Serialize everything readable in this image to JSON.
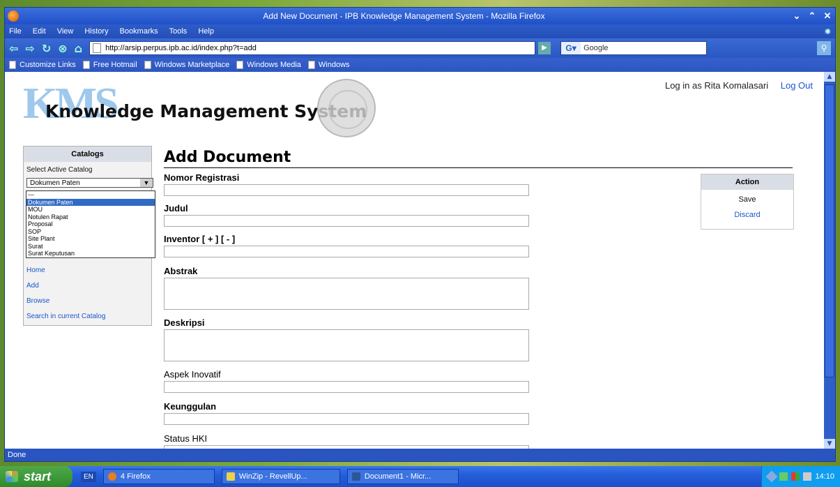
{
  "window": {
    "title": "Add New Document - IPB Knowledge Management System - Mozilla Firefox",
    "controls": [
      "⌄",
      "⌃",
      "✕"
    ]
  },
  "menu": [
    "File",
    "Edit",
    "View",
    "History",
    "Bookmarks",
    "Tools",
    "Help"
  ],
  "nav": {
    "url": "http://arsip.perpus.ipb.ac.id/index.php?t=add",
    "search_placeholder": "Google"
  },
  "bookmarks": [
    "Customize Links",
    "Free Hotmail",
    "Windows Marketplace",
    "Windows Media",
    "Windows"
  ],
  "page": {
    "logo_kms": "KMS",
    "logo_text": "Knowledge Management System",
    "user": {
      "login_text": "Log in as Rita Komalasari",
      "logout": "Log Out"
    },
    "sidebar": {
      "title": "Catalogs",
      "select_label": "Select Active Catalog",
      "selected": "Dokumen Paten",
      "options": [
        "---",
        "Dokumen Paten",
        "MOU",
        "Notulen Rapat",
        "Proposal",
        "SOP",
        "Site Plant",
        "Surat",
        "Surat Keputusan"
      ],
      "links": [
        "Home",
        "Add",
        "Browse",
        "Search in current Catalog"
      ]
    },
    "heading": "Add Document",
    "fields": [
      {
        "label": "Nomor Registrasi"
      },
      {
        "label": "Judul"
      },
      {
        "label": "Inventor [ + ] [ - ]"
      },
      {
        "label": "Abstrak"
      },
      {
        "label": "Deskripsi"
      },
      {
        "label": "Aspek Inovatif"
      },
      {
        "label": "Keunggulan"
      },
      {
        "label": "Status HKI"
      }
    ],
    "action": {
      "title": "Action",
      "save": "Save",
      "discard": "Discard"
    }
  },
  "status": "Done",
  "taskbar": {
    "start": "start",
    "lang": "EN",
    "tasks": [
      "4 Firefox",
      "WinZip - RevellUp...",
      "Document1 - Micr..."
    ],
    "clock": "14:10"
  }
}
